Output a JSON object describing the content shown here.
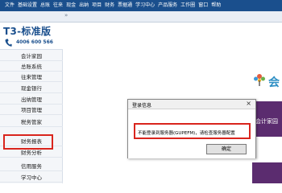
{
  "menubar": {
    "items": [
      "文件",
      "基础设置",
      "总账",
      "往来",
      "现金",
      "出纳",
      "项目",
      "财务",
      "票据通",
      "学习中心",
      "产品服务",
      "工作圈",
      "窗口",
      "帮助"
    ]
  },
  "toolbar": {
    "collapse_glyph": "»"
  },
  "brand": {
    "title": "T3-标准版",
    "phone": "4006 600 566"
  },
  "sidebar": {
    "items": [
      "会计家园",
      "总账系统",
      "往来管理",
      "现金银行",
      "出纳管理",
      "项目管理",
      "税务管家",
      "财务报表",
      "财务分析",
      "信用服务",
      "学习中心"
    ],
    "selected": "财务报表"
  },
  "main": {
    "logo_glyph": "会",
    "tile_text": "会计家园"
  },
  "dialog": {
    "title": "登录信息",
    "close_glyph": "×",
    "message": "不能登录到服务器(GUPEFM)，请检查服务器配置",
    "ok_label": "确定"
  },
  "colors": {
    "menubar": "#1a4f8d",
    "highlight": "#d9251d",
    "tile": "#5b2c6f"
  }
}
